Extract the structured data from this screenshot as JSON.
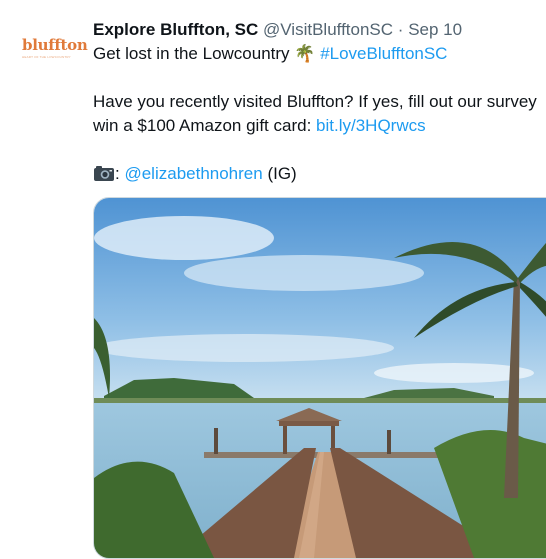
{
  "tweet": {
    "avatar_logo": "bluffton",
    "avatar_tagline": "HEART OF THE LOWCOUNTRY",
    "author_name": "Explore Bluffton, SC",
    "author_handle": "@VisitBlufftonSC",
    "separator": "·",
    "date": "Sep 10",
    "line1_text": "Get lost in the Lowcountry",
    "line1_emoji": "🌴",
    "line1_hashtag": "#LoveBlufftonSC",
    "body_line1": "Have you recently visited Bluffton? If yes, fill out our survey",
    "body_line2_text": "win a $100 Amazon gift card:",
    "body_line2_link": "bit.ly/3HQrwcs",
    "credit_prefix": ":",
    "credit_handle": "@elizabethnohren",
    "credit_suffix": "(IG)",
    "photo_icon": "camera-icon"
  },
  "colors": {
    "link": "#1d9bf0",
    "secondary_text": "#536471",
    "brand_orange": "#e07a3a"
  }
}
